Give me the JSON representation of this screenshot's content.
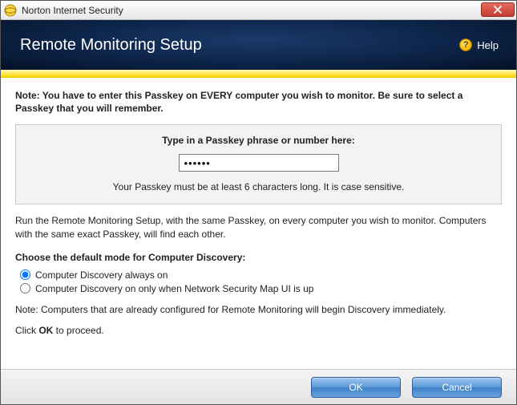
{
  "window": {
    "title": "Norton Internet Security"
  },
  "banner": {
    "title": "Remote Monitoring Setup",
    "help_label": "Help"
  },
  "note": {
    "prefix": "Note:",
    "text": "You have to enter this Passkey on EVERY computer you wish to monitor. Be sure to select a Passkey that you will remember."
  },
  "passkey": {
    "label": "Type in a Passkey phrase or number here:",
    "value": "••••••",
    "hint": "Your Passkey must be at least 6 characters long. It is case sensitive."
  },
  "instructions": "Run the Remote Monitoring Setup, with the same Passkey, on every computer you wish to monitor. Computers with the same exact Passkey, will find each other.",
  "discovery": {
    "label": "Choose the default mode for Computer Discovery:",
    "options": [
      {
        "label": "Computer Discovery always on",
        "selected": true
      },
      {
        "label": "Computer Discovery on only when Network Security Map UI is up",
        "selected": false
      }
    ]
  },
  "note2": "Note: Computers that are already configured for Remote Monitoring will begin Discovery immediately.",
  "proceed": {
    "prefix": "Click ",
    "bold": "OK",
    "suffix": " to proceed."
  },
  "footer": {
    "ok": "OK",
    "cancel": "Cancel"
  }
}
